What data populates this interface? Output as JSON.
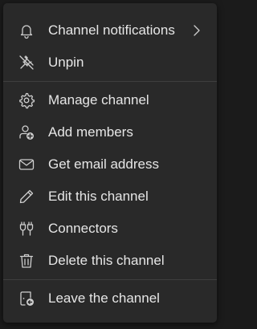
{
  "menu": {
    "items": [
      {
        "label": "Channel notifications",
        "icon": "bell-icon",
        "has_submenu": true
      },
      {
        "label": "Unpin",
        "icon": "unpin-icon"
      },
      {
        "label": "Manage channel",
        "icon": "gear-icon"
      },
      {
        "label": "Add members",
        "icon": "add-person-icon"
      },
      {
        "label": "Get email address",
        "icon": "mail-icon"
      },
      {
        "label": "Edit this channel",
        "icon": "pencil-icon"
      },
      {
        "label": "Connectors",
        "icon": "plug-icon"
      },
      {
        "label": "Delete this channel",
        "icon": "trash-icon"
      },
      {
        "label": "Leave the channel",
        "icon": "leave-icon"
      }
    ]
  },
  "colors": {
    "menu_background": "#292929",
    "page_background": "#1b1b1b",
    "text": "#e6e6e6",
    "icon": "#cfcfcf",
    "divider": "#3e3e3e"
  }
}
